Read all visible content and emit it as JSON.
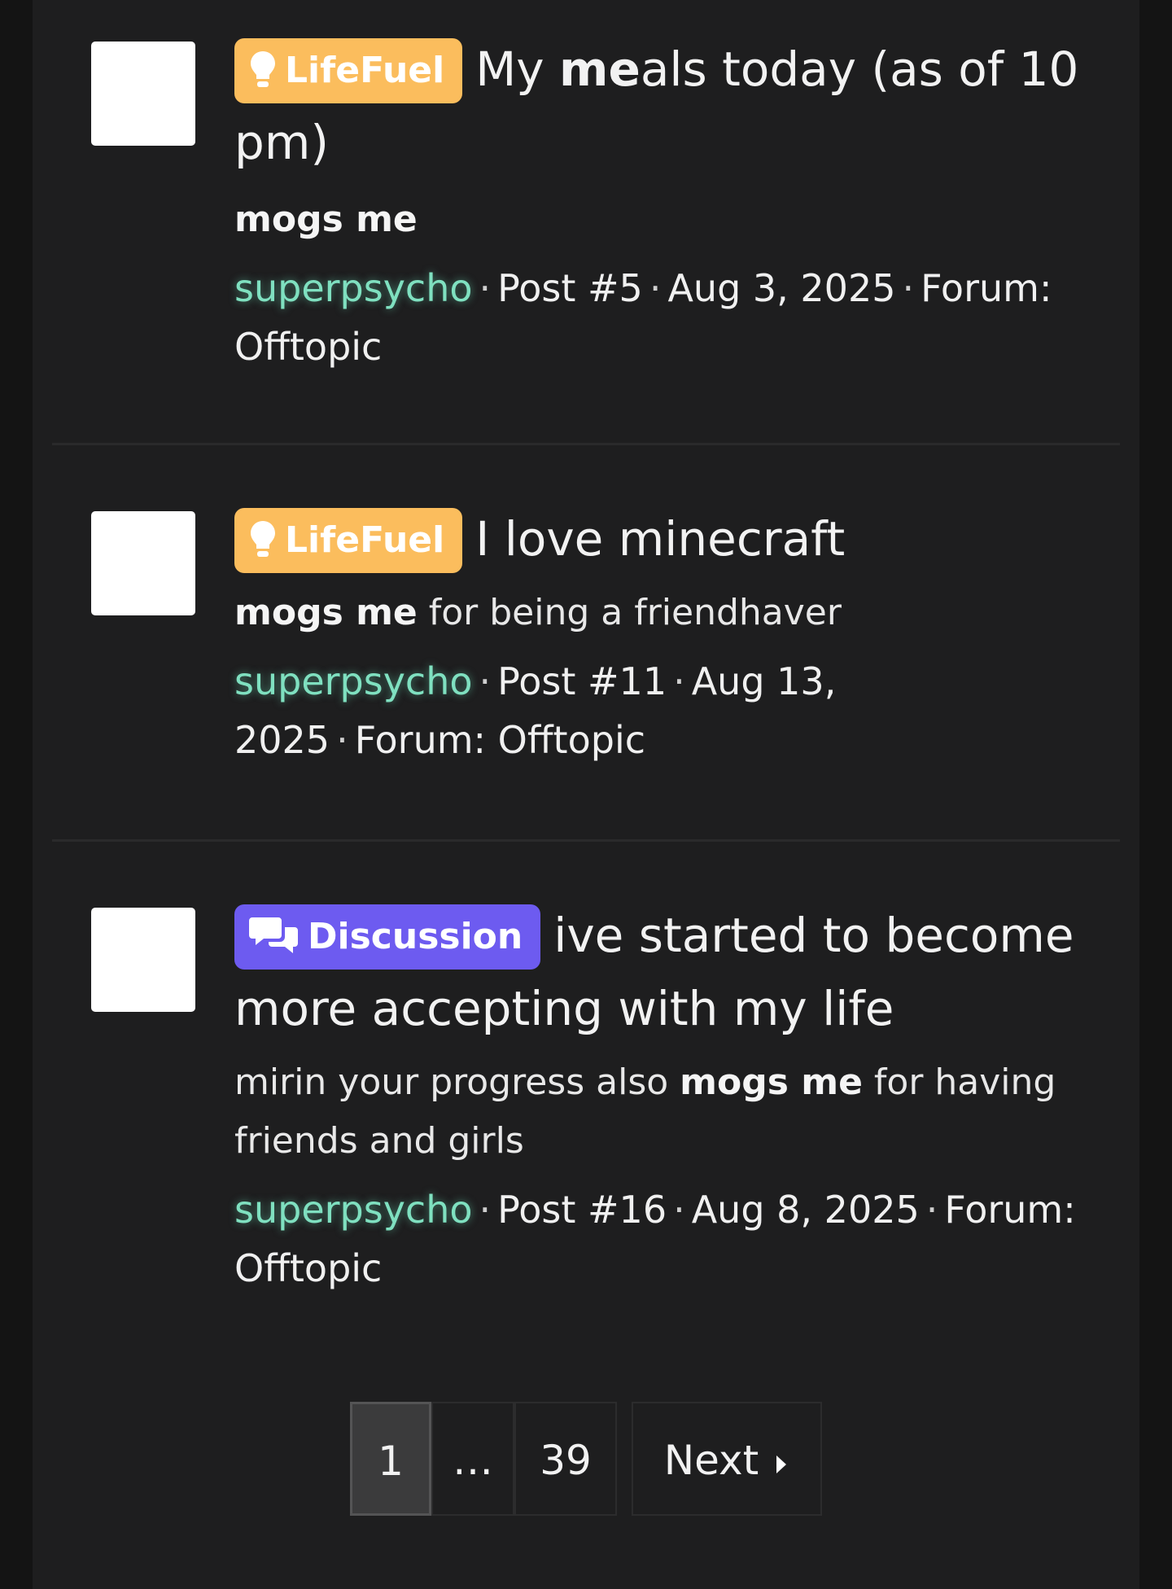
{
  "results": [
    {
      "prefix": "LifeFuel",
      "title_before": "My ",
      "title_bold": "me",
      "title_after": "als today (as of 10 pm)",
      "snippet_bold": "mogs me",
      "snippet_text": "",
      "username": "superpsycho",
      "post": "Post #5",
      "date": "Aug 3, 2025",
      "forum": "Forum: Offtopic"
    },
    {
      "prefix": "LifeFuel",
      "title_before": "I love minecraft",
      "title_bold": "",
      "title_after": "",
      "snippet_bold": "mogs me",
      "snippet_text": " for being a friendhaver",
      "username": "superpsycho",
      "post": "Post #11",
      "date": "Aug 13, 2025",
      "forum": "Forum: Offtopic"
    },
    {
      "prefix": "Discussion",
      "title_before": "ive started to become more accepting with my life",
      "title_bold": "",
      "title_after": "",
      "snippet_pre": "mirin your progress also ",
      "snippet_bold": "mogs me",
      "snippet_text": " for having friends and girls",
      "username": "superpsycho",
      "post": "Post #16",
      "date": "Aug 8, 2025",
      "forum": "Forum: Offtopic"
    }
  ],
  "separator": "·",
  "pagination": {
    "current": "1",
    "ellipsis": "…",
    "last": "39",
    "next_label": "Next"
  },
  "colors": {
    "lifefuel": "#fbbd5d",
    "discussion": "#6d5bf0",
    "username": "#7fe0c0"
  },
  "icons": {
    "lifefuel": "lightbulb-icon",
    "discussion": "comments-icon",
    "next": "caret-right-icon"
  }
}
